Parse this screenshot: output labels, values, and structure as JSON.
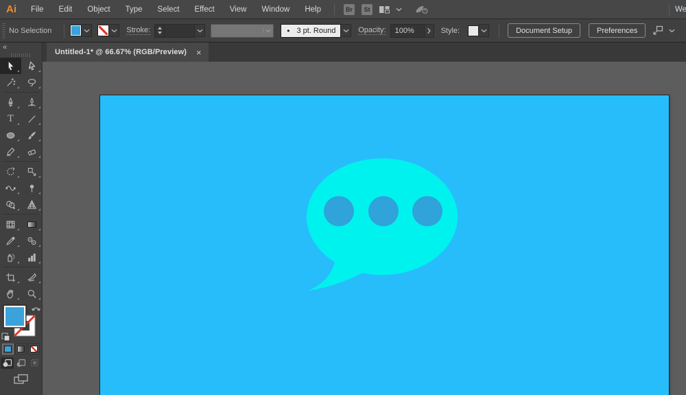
{
  "menubar": {
    "logo": "Ai",
    "items": [
      "File",
      "Edit",
      "Object",
      "Type",
      "Select",
      "Effect",
      "View",
      "Window",
      "Help"
    ],
    "bridge_button": "Br",
    "stock_button": "St",
    "workspace_partial": "We"
  },
  "controlbar": {
    "selection_status": "No Selection",
    "stroke_label": "Stroke:",
    "brush_preview": "•",
    "brush_value": "3 pt. Round",
    "opacity_label": "Opacity:",
    "opacity_value": "100%",
    "style_label": "Style:",
    "document_setup_label": "Document Setup",
    "preferences_label": "Preferences",
    "fill_color": "#3AA3DB"
  },
  "tabbar": {
    "tab_title": "Untitled-1* @ 66.67% (RGB/Preview)",
    "close_glyph": "×"
  },
  "toolbar": {
    "collapse_glyph": "«",
    "active_tool": "selection",
    "fill_color": "#3AA3DB",
    "tools": [
      "selection",
      "direct-selection",
      "magic-wand",
      "lasso",
      "pen",
      "curvature",
      "type",
      "line-segment",
      "ellipse",
      "paintbrush",
      "shaper",
      "eraser",
      "rotate",
      "scale",
      "width",
      "puppet-warp",
      "shape-builder",
      "perspective-grid",
      "mesh",
      "gradient",
      "eyedropper",
      "blend",
      "symbol-sprayer",
      "column-graph",
      "artboard",
      "slice",
      "hand",
      "zoom"
    ]
  },
  "canvas": {
    "artboard_color": "#27BDFB",
    "bubble_color": "#00F2EF",
    "dot_color": "#2FA3DA"
  }
}
